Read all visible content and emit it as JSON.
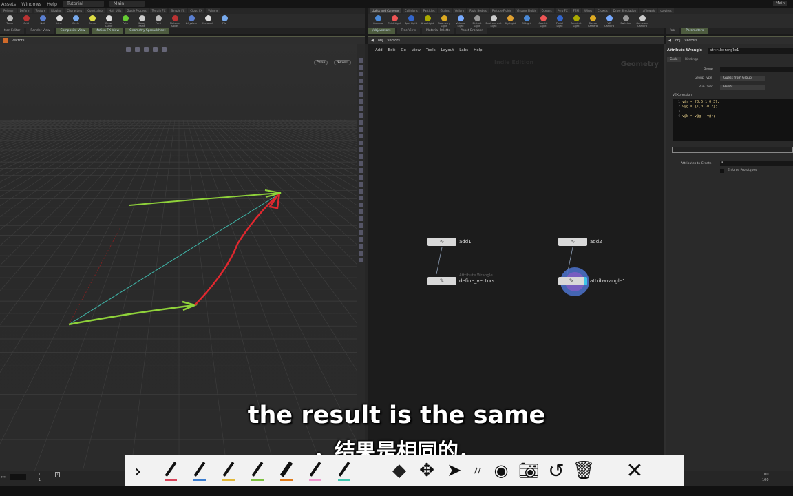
{
  "menubar": {
    "items": [
      "Assets",
      "Windows",
      "Help"
    ],
    "desktop": "Tutorial",
    "desktop2": "Main",
    "corner": "Main"
  },
  "shelf_left": {
    "tabs": [
      "Polygon",
      "Deform",
      "Texture",
      "Rigging",
      "Characters",
      "Constraints",
      "Hair Utils",
      "Guide Process",
      "Terrain FX",
      "Simple FX",
      "Cloud FX",
      "Volume"
    ],
    "tools": [
      "Torus",
      "Grid",
      "Null",
      "Line",
      "Circle",
      "Curve",
      "Draw Curve",
      "Path",
      "Spray Paint",
      "Font",
      "Platonic Solids",
      "L-System",
      "Metaball",
      "File"
    ]
  },
  "shelf_right": {
    "tabs": [
      "Lights and Cameras",
      "Collisions",
      "Particles",
      "Grains",
      "Vellum",
      "Rigid Bodies",
      "Particle Fluids",
      "Viscous Fluids",
      "Oceans",
      "Pyro FX",
      "FEM",
      "Wires",
      "Crowds",
      "Drive Simulation",
      "rafficwalk",
      "colvines"
    ],
    "tools": [
      "Camera",
      "Point Light",
      "Spot Light",
      "Area Light",
      "Geometry Light",
      "Volume Light",
      "Distant Light",
      "Environment Light",
      "Sky Light",
      "GI Light",
      "Caustic Light",
      "Portal Light",
      "Ambient Light",
      "Stereo Camera",
      "VR Camera",
      "Switcher",
      "Gamepad Camera"
    ]
  },
  "panes_left": {
    "tabs": [
      "tion Editor",
      "Render View",
      "Composite View",
      "Motion FX View",
      "Geometry Spreadsheet"
    ],
    "path": "vectors"
  },
  "panes_mid": {
    "tabs": [
      "/obj/vectors",
      "Tree View",
      "Material Palette",
      "Asset Browser"
    ],
    "path_obj": "obj",
    "path_node": "vectors"
  },
  "panes_right": {
    "tabs": [
      "/obj",
      "Parameters"
    ],
    "path_obj": "obj",
    "path_node": "vectors"
  },
  "viewport": {
    "persp": "Persp",
    "cam": "No cam"
  },
  "node_editor": {
    "menu": [
      "Add",
      "Edit",
      "Go",
      "View",
      "Tools",
      "Layout",
      "Labs",
      "Help"
    ],
    "watermark": "Indie Edition",
    "context": "Geometry",
    "nodes": {
      "add1": "add1",
      "add2": "add2",
      "define_vectors": "define_vectors",
      "define_type": "Attribute Wrangle",
      "attribwrangle1": "attribwrangle1"
    }
  },
  "params": {
    "node_type": "Attribute Wrangle",
    "node_name": "attriberangle1",
    "tabs": [
      "Code",
      "Bindings"
    ],
    "group_label": "Group",
    "group_value": "",
    "group_type_label": "Group Type",
    "group_type": "Guess from Group",
    "run_over_label": "Run Over",
    "run_over": "Points",
    "vex_label": "VEXpression",
    "code": [
      {
        "n": "1",
        "t": "v@r = {0.5,1,0.3};"
      },
      {
        "n": "2",
        "t": "v@g = {1,0,-0.2};"
      },
      {
        "n": "3",
        "t": ""
      },
      {
        "n": "4",
        "t": "v@b = v@g + v@r;"
      }
    ],
    "attrs_label": "Attributes to Create",
    "attrs_value": "*",
    "enforce_label": "Enforce Prototypes"
  },
  "timeline": {
    "frame": "1",
    "start": "1",
    "start2": "1",
    "end": "100",
    "end2": "100",
    "marker": "1"
  },
  "subtitles": {
    "en": "the result is the same",
    "zh": "，结果是相同的，"
  },
  "drawbar": {
    "pen_colors": [
      "#d9455a",
      "#3c7ed0",
      "#e2b93b",
      "#7fc241",
      "#e07b1a",
      "#f09ad0",
      "#3fc6b0"
    ]
  },
  "colors": {
    "green_arrow": "#8fd23a",
    "red_arrow": "#e0282f",
    "cyan_line": "#3fb5a8"
  }
}
